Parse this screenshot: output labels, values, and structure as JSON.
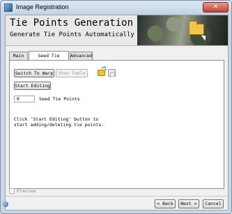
{
  "window": {
    "title": "Image Registration",
    "close_label": "✕"
  },
  "banner": {
    "title": "Tie Points Generation",
    "subtitle": "Generate Tie Points Automatically"
  },
  "tabs": [
    {
      "label": "Main",
      "active": false
    },
    {
      "label": "Seed Tie Points",
      "active": true
    },
    {
      "label": "Advanced",
      "active": false
    }
  ],
  "panel": {
    "switch_label": "Switch To Warp",
    "show_table_label": "Show Table",
    "start_editing_label": "Start Editing",
    "seed_count": "0",
    "seed_count_label": "Seed Tie Points",
    "hint": "Click 'Start Editing' button to start adding/deleting tie points."
  },
  "footer": {
    "preview_label": "Preview",
    "back_label": "< Back",
    "next_label": "Next >",
    "cancel_label": "Cancel"
  },
  "colors": {
    "frame": "#c9d6e6",
    "close": "#c2412d",
    "panel_bg": "#f0f0f0"
  },
  "icons": [
    "app-icon",
    "folder-icon",
    "cursor-icon",
    "open-file-icon",
    "save-icon",
    "close-icon",
    "help-icon"
  ]
}
